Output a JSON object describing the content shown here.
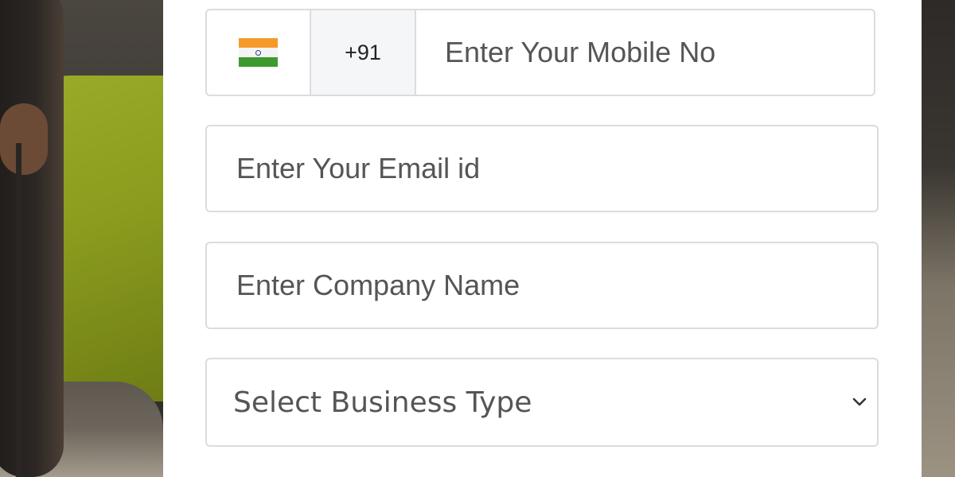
{
  "form": {
    "phone": {
      "country_flag": "india-flag-icon",
      "country_code": "+91",
      "placeholder": "Enter Your Mobile No"
    },
    "email": {
      "placeholder": "Enter Your Email id"
    },
    "company": {
      "placeholder": "Enter Company Name"
    },
    "business_type": {
      "selected": "Select Business Type",
      "icon": "chevron-down-icon"
    }
  },
  "colors": {
    "border": "#dcdcdc",
    "placeholder_text": "#555555",
    "code_bg": "#f5f6f7",
    "flag_saffron": "#f59a2a",
    "flag_green": "#3e9a2e"
  }
}
